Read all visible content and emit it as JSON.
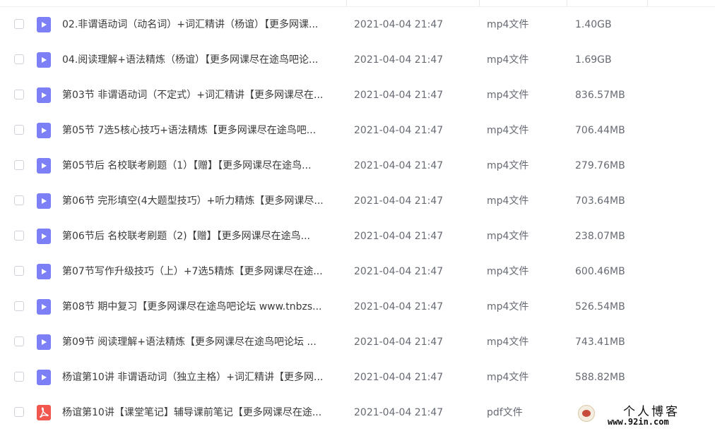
{
  "files": [
    {
      "name": "02.非谓语动词（动名词）+词汇精讲（杨谊）【更多网课...",
      "time": "2021-04-04 21:47",
      "type": "mp4文件",
      "size": "1.40GB",
      "kind": "video"
    },
    {
      "name": "04.阅读理解+语法精炼（杨谊）【更多网课尽在途鸟吧论...",
      "time": "2021-04-04 21:47",
      "type": "mp4文件",
      "size": "1.69GB",
      "kind": "video"
    },
    {
      "name": "第03节 非谓语动词（不定式）+词汇精讲【更多网课尽在...",
      "time": "2021-04-04 21:47",
      "type": "mp4文件",
      "size": "836.57MB",
      "kind": "video"
    },
    {
      "name": "第05节 7选5核心技巧+语法精炼【更多网课尽在途鸟吧...",
      "time": "2021-04-04 21:47",
      "type": "mp4文件",
      "size": "706.44MB",
      "kind": "video"
    },
    {
      "name": "第05节后 名校联考刷题（1）【赠】【更多网课尽在途鸟...",
      "time": "2021-04-04 21:47",
      "type": "mp4文件",
      "size": "279.76MB",
      "kind": "video"
    },
    {
      "name": "第06节 完形填空(4大题型技巧）+听力精炼【更多网课尽...",
      "time": "2021-04-04 21:47",
      "type": "mp4文件",
      "size": "703.64MB",
      "kind": "video"
    },
    {
      "name": "第06节后 名校联考刷题（2)【赠】【更多网课尽在途鸟...",
      "time": "2021-04-04 21:47",
      "type": "mp4文件",
      "size": "238.07MB",
      "kind": "video"
    },
    {
      "name": "第07节写作升级技巧（上）+7选5精炼【更多网课尽在途...",
      "time": "2021-04-04 21:47",
      "type": "mp4文件",
      "size": "600.46MB",
      "kind": "video"
    },
    {
      "name": "第08节 期中复习【更多网课尽在途鸟吧论坛 www.tnbzs...",
      "time": "2021-04-04 21:47",
      "type": "mp4文件",
      "size": "526.54MB",
      "kind": "video"
    },
    {
      "name": "第09节 阅读理解+语法精炼【更多网课尽在途鸟吧论坛 ...",
      "time": "2021-04-04 21:47",
      "type": "mp4文件",
      "size": "743.41MB",
      "kind": "video"
    },
    {
      "name": "杨谊第10讲 非谓语动词（独立主格）+词汇精讲【更多网...",
      "time": "2021-04-04 21:47",
      "type": "mp4文件",
      "size": "588.82MB",
      "kind": "video"
    },
    {
      "name": "杨谊第10讲【课堂笔记】辅导课前笔记【更多网课尽在途...",
      "time": "2021-04-04 21:47",
      "type": "pdf文件",
      "size": "",
      "kind": "pdf"
    }
  ],
  "watermark": {
    "title": "个人博客",
    "url": "www.92in.com"
  },
  "colors": {
    "video_icon": "#7c7ff5",
    "pdf_icon": "#f2574f"
  }
}
